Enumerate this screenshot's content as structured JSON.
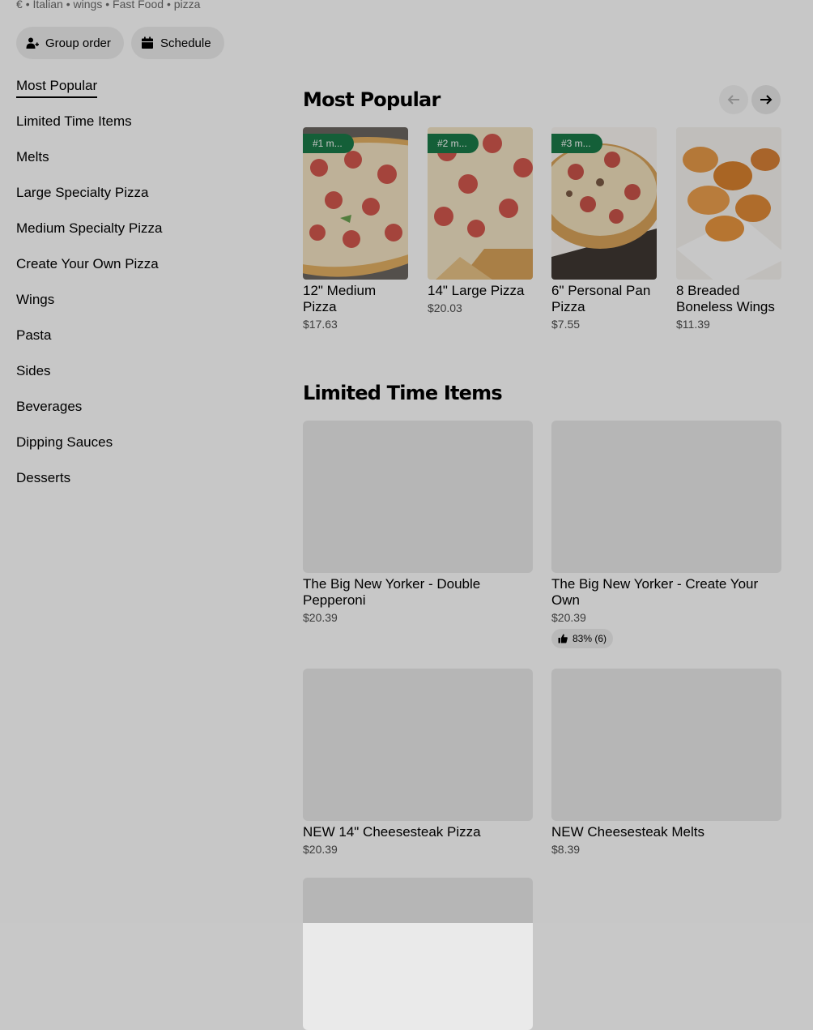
{
  "store_meta": {
    "price_symbol": "€",
    "cuisines": [
      "Italian",
      "wings",
      "Fast Food",
      "pizza"
    ],
    "separator": "•"
  },
  "actions": {
    "group_order": "Group order",
    "schedule": "Schedule"
  },
  "sidebar": {
    "items": [
      {
        "label": "Most Popular",
        "active": true
      },
      {
        "label": "Limited Time Items"
      },
      {
        "label": "Melts"
      },
      {
        "label": "Large Specialty Pizza"
      },
      {
        "label": "Medium Specialty Pizza"
      },
      {
        "label": "Create Your Own Pizza"
      },
      {
        "label": "Wings"
      },
      {
        "label": "Pasta"
      },
      {
        "label": "Sides"
      },
      {
        "label": "Beverages"
      },
      {
        "label": "Dipping Sauces"
      },
      {
        "label": "Desserts"
      }
    ]
  },
  "most_popular": {
    "title": "Most Popular",
    "items": [
      {
        "badge": "#1 m...",
        "name": "12\" Medium Pizza",
        "price": "$17.63",
        "image": "pepperoni-pizza"
      },
      {
        "badge": "#2 m...",
        "name": "14\" Large Pizza",
        "price": "$20.03",
        "image": "pepperoni-pizza-slice"
      },
      {
        "badge": "#3 m...",
        "name": "6\" Personal Pan Pizza",
        "price": "$7.55",
        "image": "pan-pizza"
      },
      {
        "badge": "",
        "name": "8 Breaded Boneless Wings",
        "price": "$11.39",
        "image": "boneless-wings"
      }
    ]
  },
  "limited_time": {
    "title": "Limited Time Items",
    "items": [
      {
        "name": "The Big New Yorker - Double Pepperoni",
        "price": "$20.39"
      },
      {
        "name": "The Big New Yorker - Create Your Own",
        "price": "$20.39",
        "rating": "83% (6)"
      },
      {
        "name": "NEW 14\" Cheesesteak Pizza",
        "price": "$20.39"
      },
      {
        "name": "NEW Cheesesteak Melts",
        "price": "$8.39"
      },
      {
        "name": "",
        "price": ""
      }
    ]
  },
  "colors": {
    "badge_green": "#1a7a48",
    "overlay": "rgba(0,0,0,0.22)",
    "chip_bg": "#eeeeee"
  }
}
